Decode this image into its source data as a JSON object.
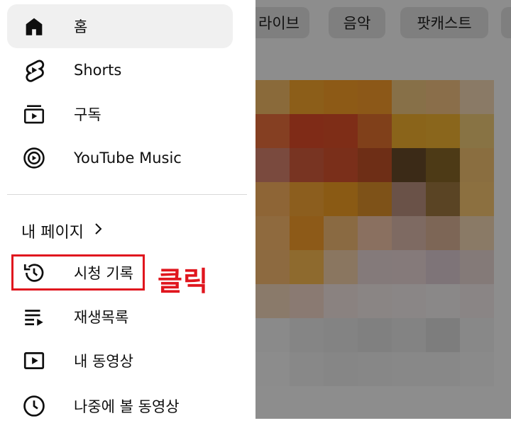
{
  "chips": [
    {
      "label": "라이브"
    },
    {
      "label": "음악"
    },
    {
      "label": "팟캐스트"
    }
  ],
  "drawer": {
    "main_items": [
      {
        "label": "홈",
        "icon": "home-icon",
        "selected": true
      },
      {
        "label": "Shorts",
        "icon": "shorts-icon"
      },
      {
        "label": "구독",
        "icon": "subscriptions-icon"
      },
      {
        "label": "YouTube Music",
        "icon": "youtube-music-icon"
      }
    ],
    "section_header": {
      "label": "내 페이지",
      "icon": "chevron-right-icon"
    },
    "you_items": [
      {
        "label": "시청 기록",
        "icon": "history-icon"
      },
      {
        "label": "재생목록",
        "icon": "playlist-icon"
      },
      {
        "label": "내 동영상",
        "icon": "your-videos-icon"
      },
      {
        "label": "나중에 볼 동영상",
        "icon": "watch-later-icon"
      }
    ]
  },
  "annotation": {
    "text": "클릭",
    "color": "#e0161e"
  },
  "colors": {
    "overlay": "#8d8d8d",
    "selected_bg": "#f0f0f0",
    "highlight": "#e0161e"
  }
}
